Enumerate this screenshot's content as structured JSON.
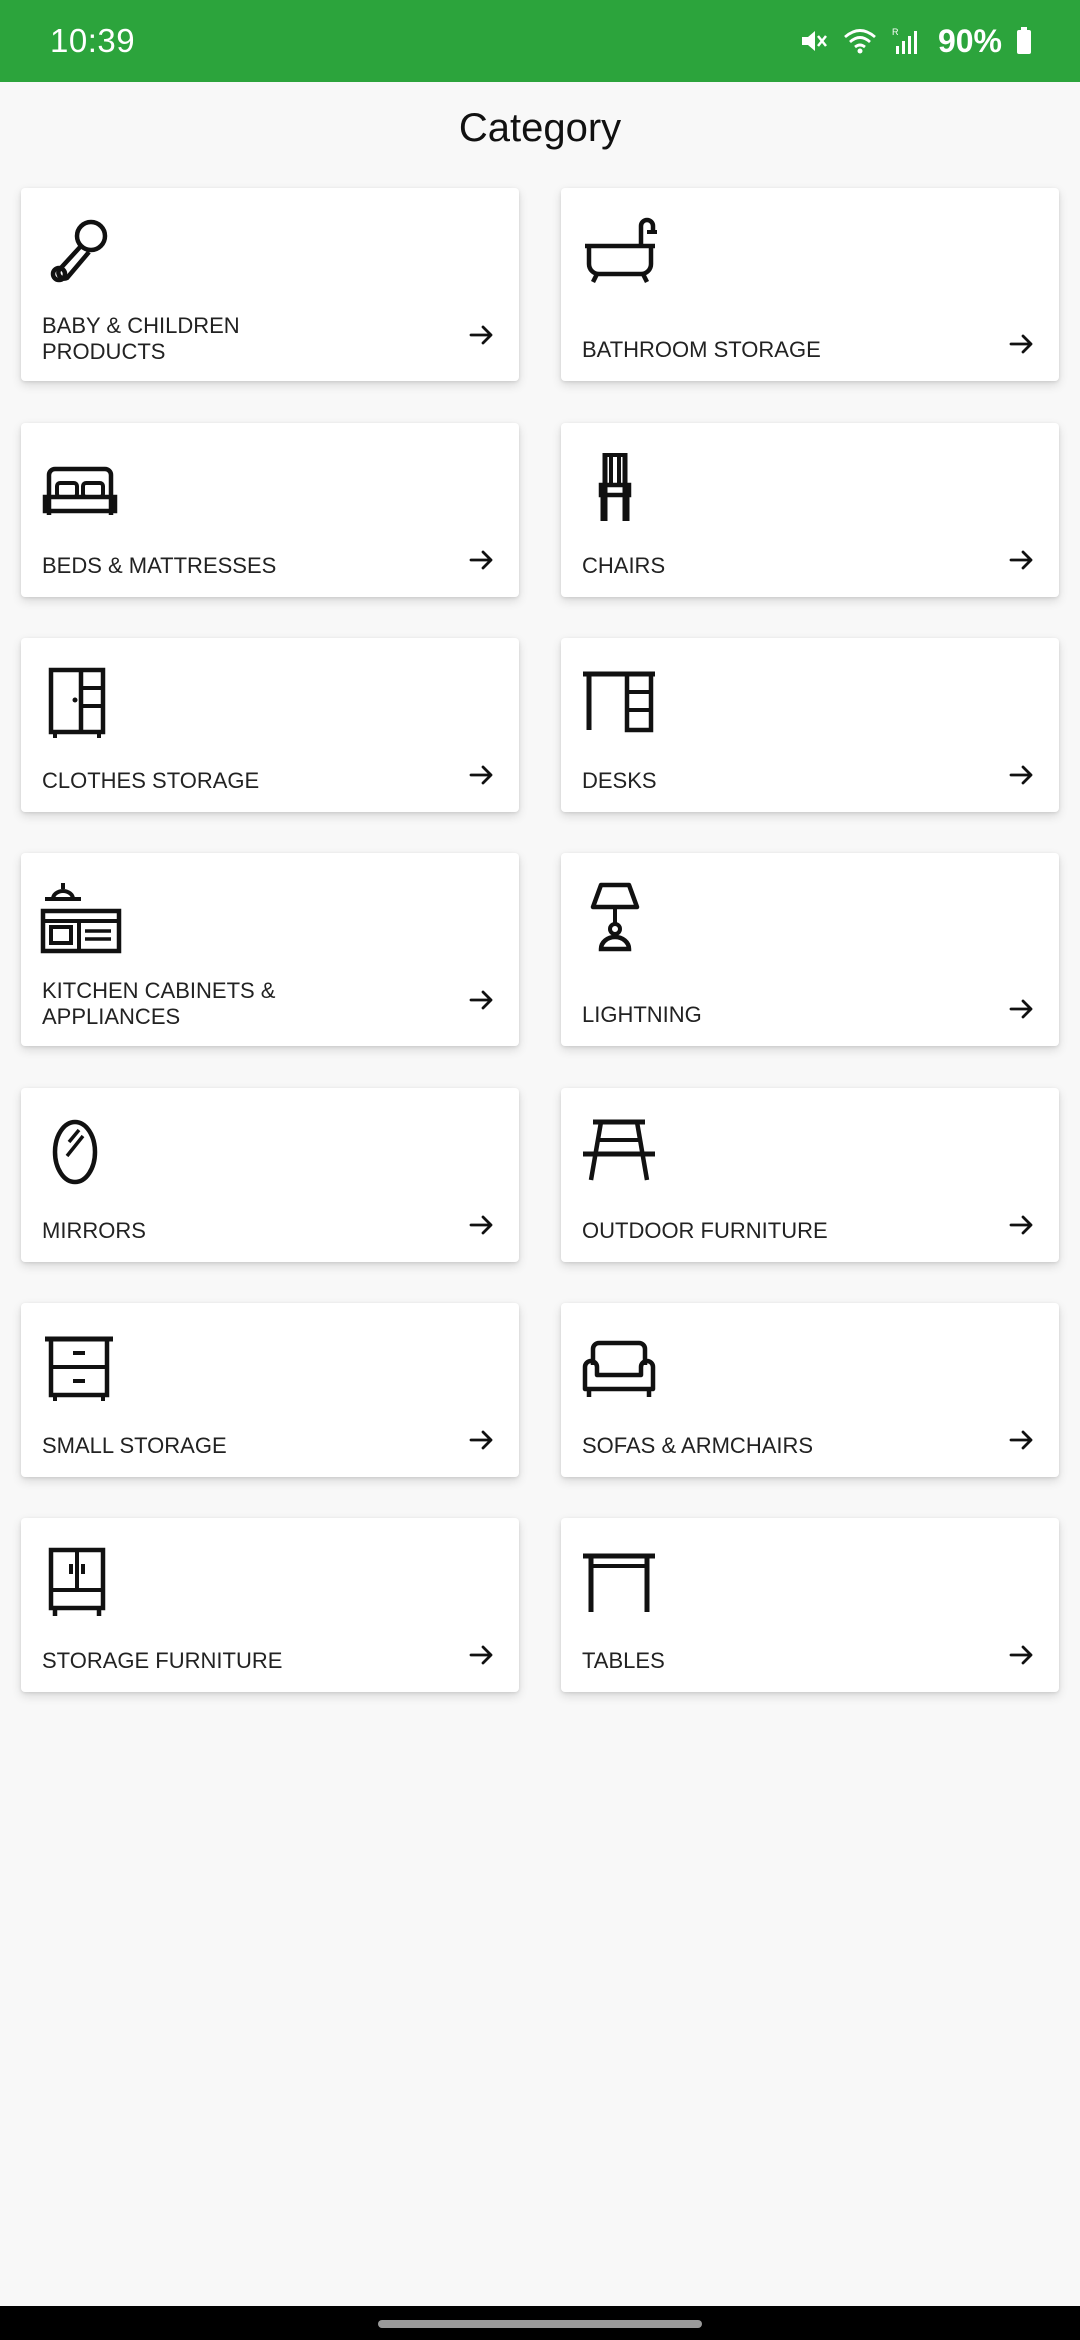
{
  "status_bar": {
    "time": "10:39",
    "battery": "90%",
    "background": "#2ca43c",
    "icons": [
      "mute-icon",
      "wifi-icon",
      "signal-icon",
      "battery-icon"
    ]
  },
  "page": {
    "title": "Category"
  },
  "categories": [
    {
      "label": "BABY & CHILDREN PRODUCTS",
      "icon": "rattle-icon"
    },
    {
      "label": "BATHROOM STORAGE",
      "icon": "bathtub-icon"
    },
    {
      "label": "BEDS & MATTRESSES",
      "icon": "bed-icon"
    },
    {
      "label": "CHAIRS",
      "icon": "chair-icon"
    },
    {
      "label": "CLOTHES STORAGE",
      "icon": "wardrobe-icon"
    },
    {
      "label": "DESKS",
      "icon": "desk-icon"
    },
    {
      "label": "KITCHEN CABINETS & APPLIANCES",
      "icon": "kitchen-icon"
    },
    {
      "label": "LIGHTNING",
      "icon": "lamp-icon"
    },
    {
      "label": "MIRRORS",
      "icon": "mirror-icon"
    },
    {
      "label": "OUTDOOR FURNITURE",
      "icon": "picnic-table-icon"
    },
    {
      "label": "SMALL STORAGE",
      "icon": "drawers-icon"
    },
    {
      "label": "SOFAS & ARMCHAIRS",
      "icon": "sofa-icon"
    },
    {
      "label": "STORAGE FURNITURE",
      "icon": "cabinet-icon"
    },
    {
      "label": "TABLES",
      "icon": "table-icon"
    }
  ]
}
